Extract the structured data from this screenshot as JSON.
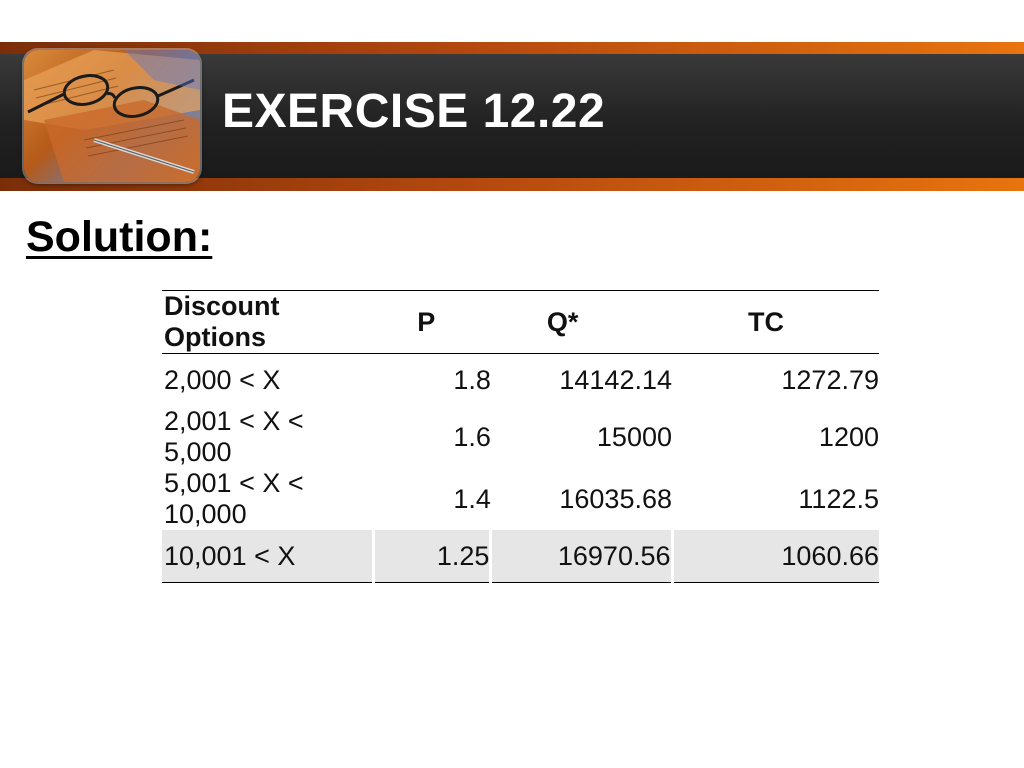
{
  "slide": {
    "title": "EXERCISE 12.22",
    "subtitle": "Solution:"
  },
  "table": {
    "headers": [
      "Discount Options",
      "P",
      "Q*",
      "TC"
    ],
    "rows": [
      [
        "2,000 < X",
        "1.8",
        "14142.14",
        "1272.79"
      ],
      [
        "2,001 < X < 5,000",
        "1.6",
        "15000",
        "1200"
      ],
      [
        "5,001 < X < 10,000",
        "1.4",
        "16035.68",
        "1122.5"
      ],
      [
        "10,001 < X",
        "1.25",
        "16970.56",
        "1060.66"
      ]
    ],
    "highlighted_row": 3
  },
  "colors": {
    "banner_dark": "#222222",
    "accent_orange": "#e8740f",
    "highlight_row": "#e6e6e6"
  },
  "icons": {
    "banner_photo": "glasses-on-financial-papers-image"
  }
}
